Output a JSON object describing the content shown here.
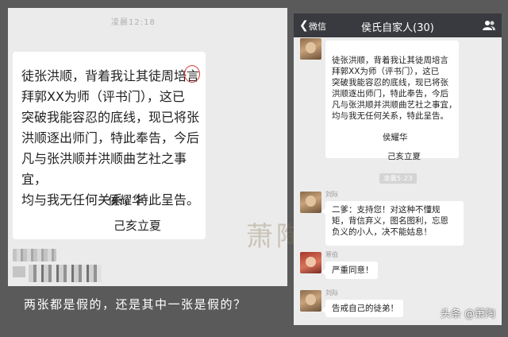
{
  "left": {
    "time": "凌晨12:18",
    "message": "徒张洪顺，背着我让其徒周培言\n拜郭XX为师（评书门），这已\n突破我能容忍的底线，现已将张\n洪顺逐出师门，特此奉告，今后\n凡与张洪顺并洪顺曲艺社之事宜，\n均与我无任何关系，特此呈告。",
    "signature_name": "侯耀华",
    "signature_date": "己亥立夏"
  },
  "watermark_center": "萧陶",
  "caption": "两张都是假的，还是其中一张是假的？",
  "right": {
    "nav": {
      "back_label": "微信",
      "back_icon": "chevron-left-icon",
      "title": "侯氏自家人(30)",
      "members_icon": "people-icon"
    },
    "message_1": {
      "text": "徒张洪顺，背着我让其徒周培言\n拜郭XX为师（评书门），这已\n突破我能容忍的底线，现已将张\n洪顺逐出师门，特此奉告，今后\n凡与张洪顺并洪顺曲艺社之事宜，\n均与我无任何关系，特此呈告。",
      "signature_name": "侯耀华",
      "signature_date": "己亥立夏"
    },
    "time_divider": "凌晨5:23",
    "messages": [
      {
        "sender": "刘际",
        "text": "二爹：支持您！对这种不懂规\n矩，背信弃义，图名图利，忘恩\n负义的小人，决不能姑息！"
      },
      {
        "sender": "寒伯",
        "text": "严重同意！"
      },
      {
        "sender": "刘际",
        "text": "告戒自己的徒弟！"
      }
    ]
  },
  "watermark_brand": "头条 @萧陶"
}
